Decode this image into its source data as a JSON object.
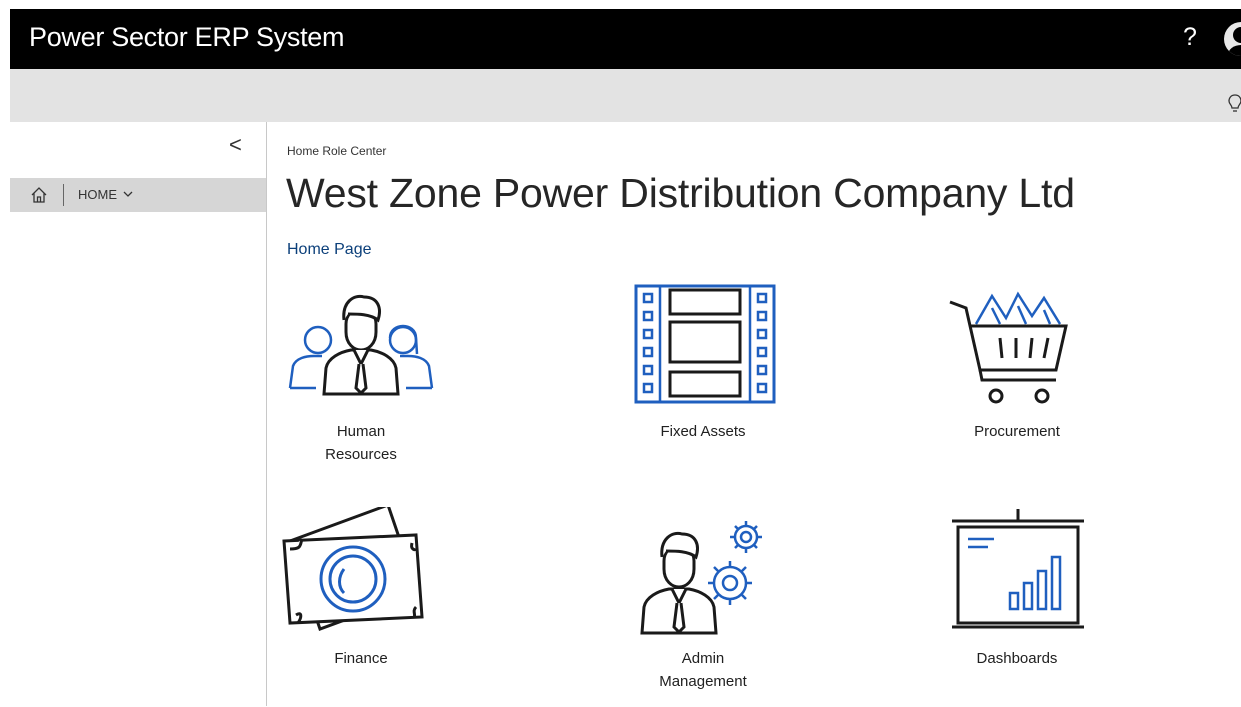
{
  "header": {
    "app_title": "Power Sector ERP System",
    "help_label": "?",
    "user_icon": "user-avatar-icon"
  },
  "actionbar": {
    "icon": "lightbulb-icon"
  },
  "sidebar": {
    "collapse_label": "<",
    "home_label": "HOME",
    "home_icon": "home-icon",
    "chevron_icon": "chevron-down-icon"
  },
  "main": {
    "breadcrumb": "Home Role Center",
    "title": "West Zone Power Distribution Company Ltd",
    "home_page_link": "Home Page",
    "tiles": [
      {
        "label": "Human\nResources",
        "icon": "human-resources-icon"
      },
      {
        "label": "Fixed Assets",
        "icon": "fixed-assets-icon"
      },
      {
        "label": "Procurement",
        "icon": "shopping-cart-icon"
      },
      {
        "label": "Finance",
        "icon": "banknote-icon"
      },
      {
        "label": "Admin\nManagement",
        "icon": "admin-gears-icon"
      },
      {
        "label": "Dashboards",
        "icon": "dashboard-chart-icon"
      }
    ]
  },
  "colors": {
    "topbar": "#000000",
    "actionbar": "#e3e3e3",
    "accent_blue": "#1f5fbf",
    "link_blue": "#0b3f7a",
    "nav_selected": "#d6d6d6"
  }
}
